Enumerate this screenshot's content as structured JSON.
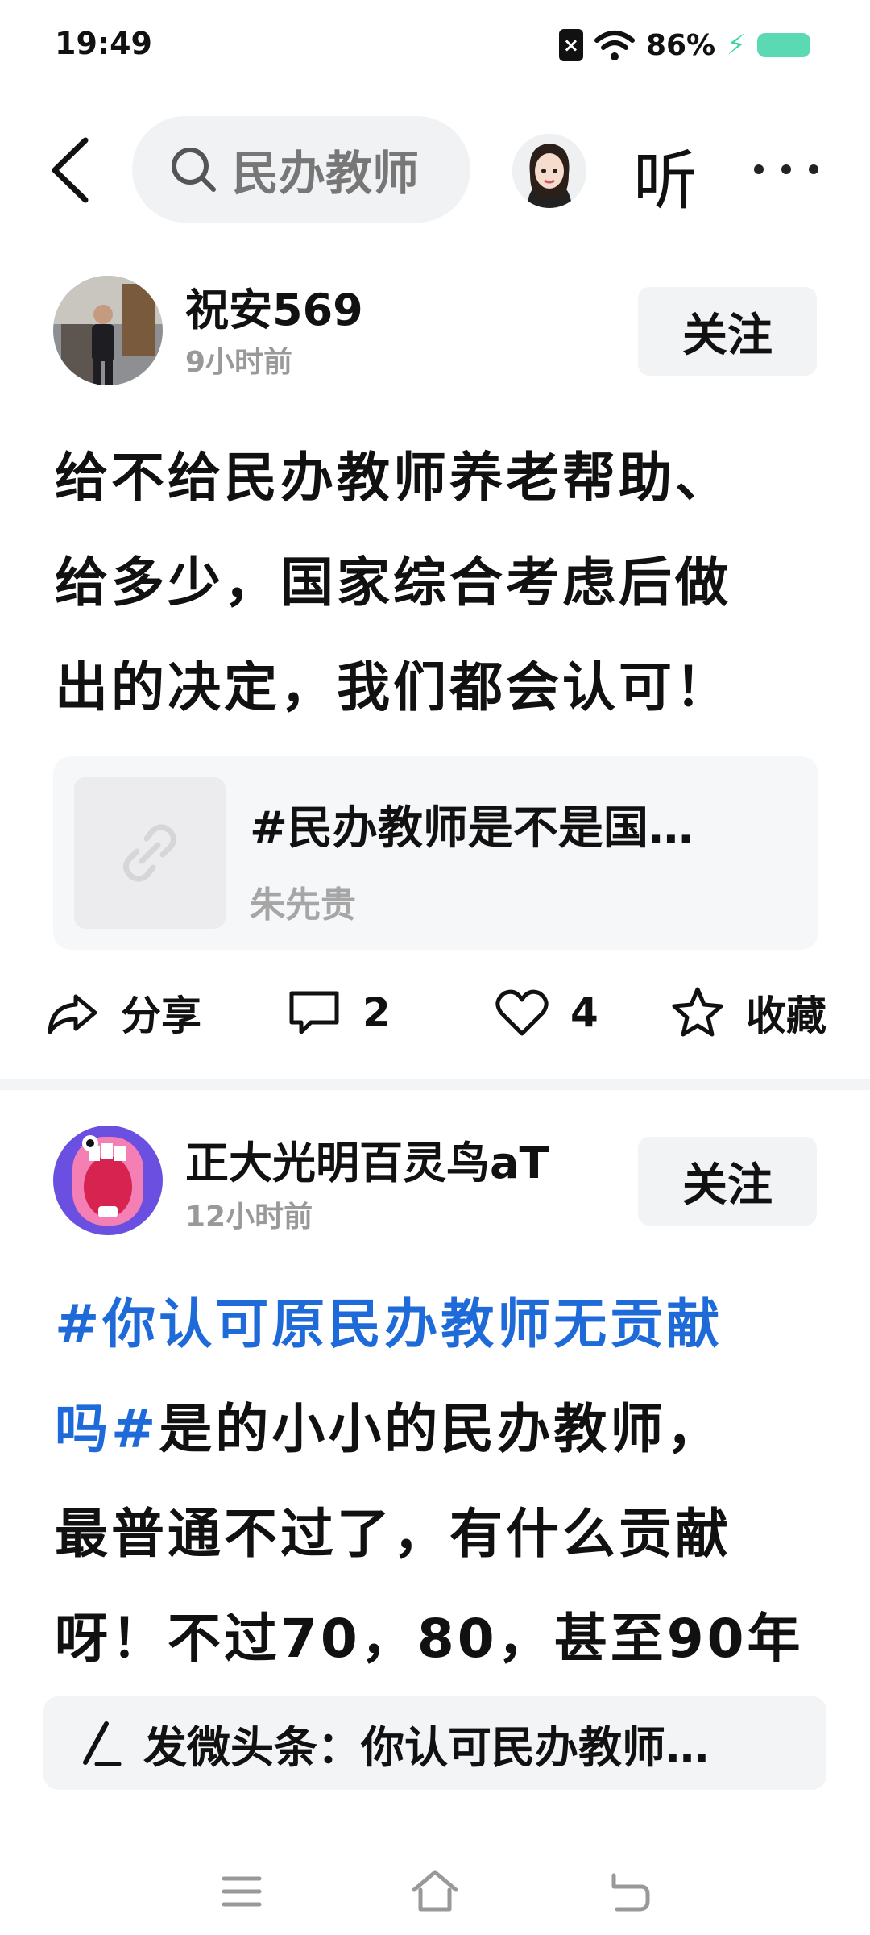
{
  "status_bar": {
    "time": "19:49",
    "sim_label": "×",
    "battery_percent": "86%",
    "icons": [
      "sim-off-icon",
      "wifi-icon",
      "charging-bolt-icon",
      "battery-icon"
    ]
  },
  "top_nav": {
    "search_text": "民办教师",
    "listen_label": "听",
    "icons": [
      "back-arrow-icon",
      "search-icon",
      "avatar",
      "more-icon"
    ]
  },
  "posts": [
    {
      "author": "祝安569",
      "time": "9小时前",
      "follow_label": "关注",
      "lines": [
        "给不给民办教师养老帮助、",
        "给多少，国家综合考虑后做",
        "出的决定，我们都会认可！"
      ],
      "link_card": {
        "title": "#民办教师是不是国…",
        "source": "朱先贵"
      },
      "actions": {
        "share_label": "分享",
        "comment_count": "2",
        "like_count": "4",
        "favorite_label": "收藏"
      }
    },
    {
      "author": "正大光明百灵鸟aT",
      "time": "12小时前",
      "follow_label": "关注",
      "line1_hashtag": "#你认可原民办教师无贡献",
      "line2_hashtag": "吗#",
      "line2_rest": "是的小小的民办教师，",
      "line3": "最普通不过了，有什么贡献",
      "line4": "呀！不过70，80，甚至90年"
    }
  ],
  "compose_bar": {
    "text": "发微头条：你认可民办教师…"
  },
  "nav_bar": {
    "icons": [
      "menu-icon",
      "home-icon",
      "back-icon"
    ]
  },
  "colors": {
    "hashtag": "#1f6ad9",
    "battery": "#5ad9b2",
    "muted": "#999999"
  }
}
